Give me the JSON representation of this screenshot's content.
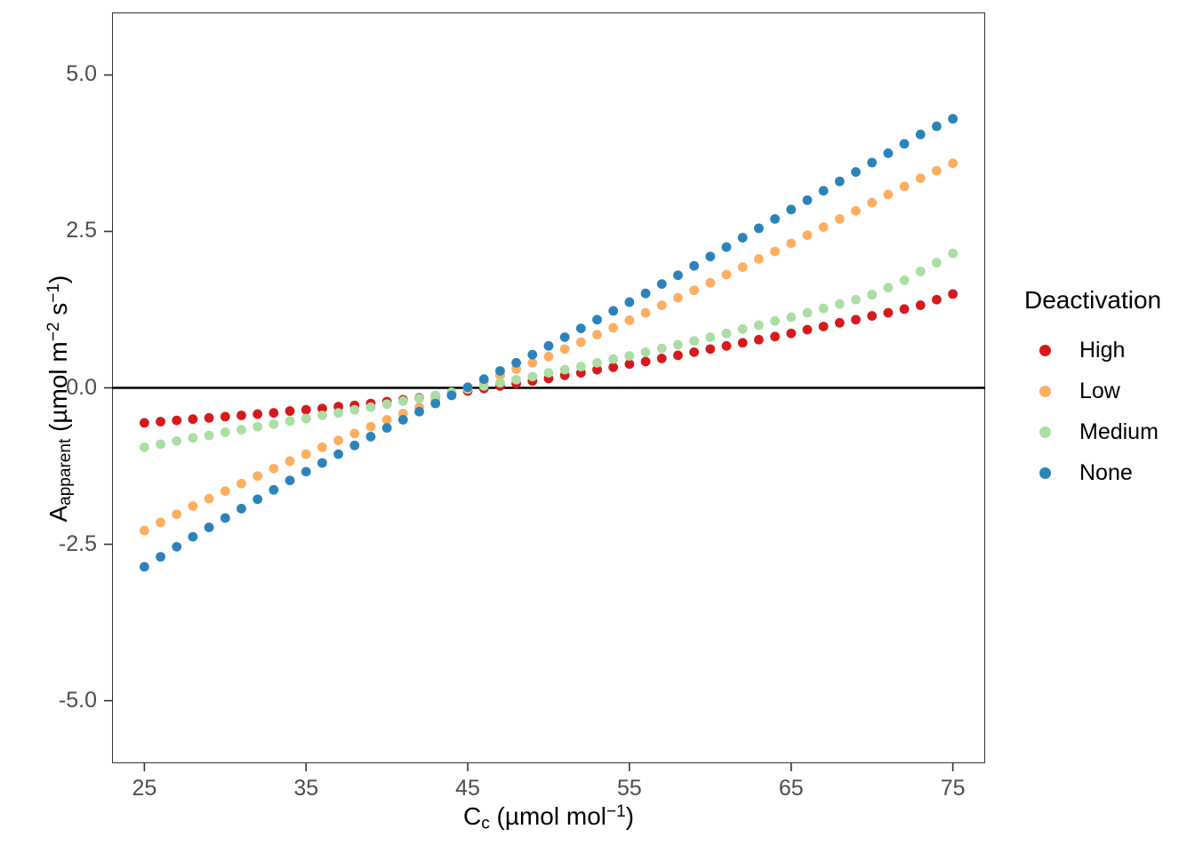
{
  "chart_data": {
    "type": "scatter",
    "title": "",
    "xlabel": "Cc (umol mol-1)",
    "ylabel": "A_apparent (umol m-2 s-1)",
    "xlim": [
      23,
      77
    ],
    "ylim": [
      -6.0,
      6.0
    ],
    "xticks": [
      25,
      35,
      45,
      55,
      65,
      75
    ],
    "yticks": [
      -5.0,
      -2.5,
      0.0,
      2.5,
      5.0
    ],
    "xtick_labels": [
      "25",
      "35",
      "45",
      "55",
      "65",
      "75"
    ],
    "ytick_labels": [
      "-5.0",
      "-2.5",
      "0.0",
      "2.5",
      "5.0"
    ],
    "grid": false,
    "legend_position": "right",
    "hline": 0.0,
    "x": [
      25,
      26,
      27,
      28,
      29,
      30,
      31,
      32,
      33,
      34,
      35,
      36,
      37,
      38,
      39,
      40,
      41,
      42,
      43,
      44,
      45,
      46,
      47,
      48,
      49,
      50,
      51,
      52,
      53,
      54,
      55,
      56,
      57,
      58,
      59,
      60,
      61,
      62,
      63,
      64,
      65,
      66,
      67,
      68,
      69,
      70,
      71,
      72,
      73,
      74,
      75
    ],
    "series": [
      {
        "name": "High",
        "color": "#D7191C",
        "values": [
          -0.56,
          -0.54,
          -0.52,
          -0.5,
          -0.48,
          -0.46,
          -0.44,
          -0.42,
          -0.4,
          -0.37,
          -0.35,
          -0.33,
          -0.3,
          -0.28,
          -0.25,
          -0.22,
          -0.19,
          -0.16,
          -0.13,
          -0.09,
          -0.05,
          -0.01,
          0.03,
          0.07,
          0.11,
          0.15,
          0.2,
          0.24,
          0.29,
          0.33,
          0.38,
          0.42,
          0.47,
          0.52,
          0.57,
          0.62,
          0.67,
          0.72,
          0.77,
          0.82,
          0.87,
          0.93,
          0.98,
          1.04,
          1.09,
          1.15,
          1.2,
          1.26,
          1.32,
          1.41,
          1.5
        ]
      },
      {
        "name": "Low",
        "color": "#FDAE61",
        "values": [
          -2.28,
          -2.15,
          -2.02,
          -1.89,
          -1.77,
          -1.65,
          -1.53,
          -1.41,
          -1.29,
          -1.17,
          -1.06,
          -0.95,
          -0.84,
          -0.73,
          -0.62,
          -0.51,
          -0.41,
          -0.31,
          -0.2,
          -0.1,
          0.0,
          0.1,
          0.2,
          0.3,
          0.4,
          0.5,
          0.62,
          0.73,
          0.85,
          0.96,
          1.08,
          1.2,
          1.32,
          1.44,
          1.56,
          1.68,
          1.81,
          1.93,
          2.06,
          2.18,
          2.31,
          2.44,
          2.57,
          2.7,
          2.83,
          2.96,
          3.09,
          3.22,
          3.35,
          3.47,
          3.59
        ]
      },
      {
        "name": "Medium",
        "color": "#ABDDA4",
        "values": [
          -0.95,
          -0.9,
          -0.85,
          -0.8,
          -0.76,
          -0.71,
          -0.67,
          -0.62,
          -0.58,
          -0.53,
          -0.49,
          -0.44,
          -0.4,
          -0.35,
          -0.31,
          -0.26,
          -0.21,
          -0.17,
          -0.12,
          -0.07,
          -0.02,
          0.03,
          0.08,
          0.13,
          0.18,
          0.24,
          0.29,
          0.34,
          0.4,
          0.46,
          0.51,
          0.57,
          0.63,
          0.69,
          0.75,
          0.81,
          0.87,
          0.94,
          1.0,
          1.07,
          1.13,
          1.2,
          1.27,
          1.34,
          1.41,
          1.49,
          1.6,
          1.72,
          1.86,
          2.0,
          2.15
        ]
      },
      {
        "name": "None",
        "color": "#2B83BA",
        "values": [
          -2.86,
          -2.7,
          -2.54,
          -2.38,
          -2.23,
          -2.08,
          -1.93,
          -1.78,
          -1.63,
          -1.48,
          -1.34,
          -1.2,
          -1.06,
          -0.92,
          -0.78,
          -0.64,
          -0.51,
          -0.38,
          -0.25,
          -0.12,
          0.01,
          0.14,
          0.27,
          0.4,
          0.53,
          0.67,
          0.81,
          0.95,
          1.09,
          1.23,
          1.37,
          1.51,
          1.66,
          1.8,
          1.95,
          2.1,
          2.25,
          2.4,
          2.55,
          2.7,
          2.85,
          3.0,
          3.15,
          3.3,
          3.45,
          3.6,
          3.75,
          3.9,
          4.05,
          4.18,
          4.3
        ]
      }
    ]
  },
  "axes": {
    "x_title_main": "C",
    "x_title_sub": "c",
    "x_title_unit_open": " (µmol mol",
    "x_title_unit_exp": "−1",
    "x_title_unit_close": ")",
    "y_title_main": "A",
    "y_title_sub": "apparent",
    "y_title_unit_open": " (µmol m",
    "y_title_unit_exp1": "−2",
    "y_title_unit_mid": " s",
    "y_title_unit_exp2": "−1",
    "y_title_unit_close": ")"
  },
  "legend": {
    "title": "Deactivation",
    "items": [
      {
        "label": "High",
        "color": "#D7191C"
      },
      {
        "label": "Low",
        "color": "#FDAE61"
      },
      {
        "label": "Medium",
        "color": "#ABDDA4"
      },
      {
        "label": "None",
        "color": "#2B83BA"
      }
    ]
  },
  "style": {
    "panel_border": "#333333",
    "tick_color": "#4D4D4D",
    "hline_color": "#000000",
    "background": "#FFFFFF"
  }
}
